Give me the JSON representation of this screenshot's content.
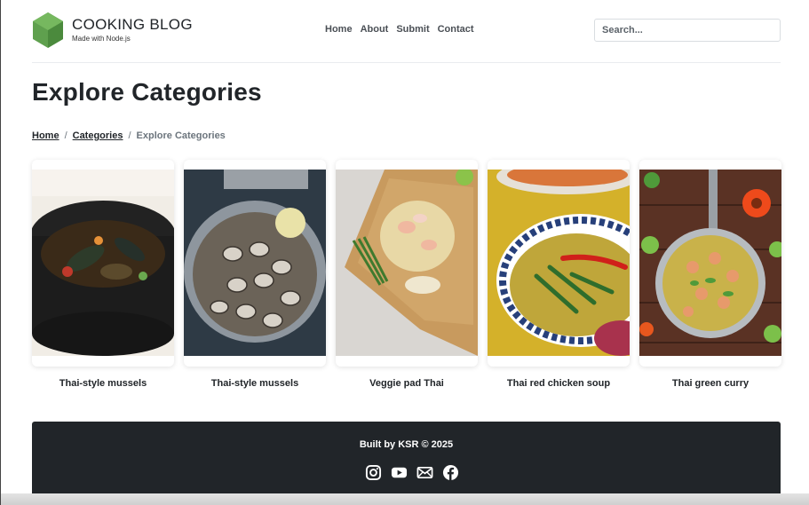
{
  "brand": {
    "title": "COOKING BLOG",
    "subtitle": "Made with Node.js",
    "logo_icon": "green-hexagon-icon",
    "accent": "#5fa04e"
  },
  "nav": [
    {
      "label": "Home"
    },
    {
      "label": "About"
    },
    {
      "label": "Submit"
    },
    {
      "label": "Contact"
    }
  ],
  "search": {
    "placeholder": "Search..."
  },
  "page_title": "Explore Categories",
  "breadcrumb": [
    {
      "label": "Home",
      "link": true
    },
    {
      "label": "Categories",
      "link": true
    },
    {
      "label": "Explore Categories",
      "link": false
    }
  ],
  "categories": [
    {
      "name": "Thai-style mussels"
    },
    {
      "name": "Thai-style mussels"
    },
    {
      "name": "Veggie pad Thai"
    },
    {
      "name": "Thai red chicken soup"
    },
    {
      "name": "Thai green curry"
    }
  ],
  "footer": {
    "text": "Built by KSR © 2025",
    "socials": [
      "instagram-icon",
      "youtube-icon",
      "mail-icon",
      "facebook-icon"
    ],
    "background": "#212529"
  }
}
